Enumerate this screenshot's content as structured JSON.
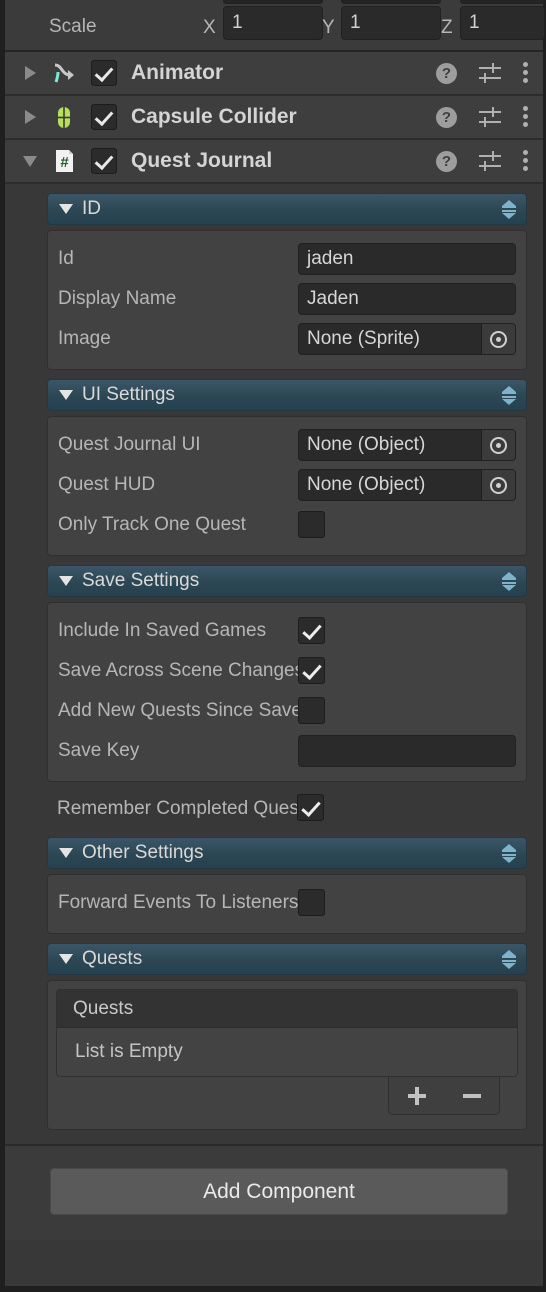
{
  "transform": {
    "scale_label": "Scale",
    "axes": [
      {
        "axis": "X",
        "value": "1"
      },
      {
        "axis": "Y",
        "value": "1"
      },
      {
        "axis": "Z",
        "value": "1"
      }
    ]
  },
  "components": [
    {
      "name": "Animator",
      "icon": "animator-icon",
      "enabled": true,
      "expanded": false
    },
    {
      "name": "Capsule Collider",
      "icon": "capsule-collider-icon",
      "enabled": true,
      "expanded": false
    },
    {
      "name": "Quest Journal",
      "icon": "csharp-script-icon",
      "enabled": true,
      "expanded": true
    }
  ],
  "header_tools": {
    "help": "?",
    "help_icon": "help-icon",
    "preset_icon": "preset-settings-icon",
    "menu_icon": "more-options-icon"
  },
  "sections": {
    "id": {
      "title": "ID",
      "rows": [
        {
          "label": "Id",
          "type": "text",
          "value": "jaden"
        },
        {
          "label": "Display Name",
          "type": "text",
          "value": "Jaden"
        },
        {
          "label": "Image",
          "type": "object",
          "value": "None (Sprite)"
        }
      ]
    },
    "ui_settings": {
      "title": "UI Settings",
      "rows": [
        {
          "label": "Quest Journal UI",
          "type": "object",
          "value": "None (Object)"
        },
        {
          "label": "Quest HUD",
          "type": "object",
          "value": "None (Object)"
        },
        {
          "label": "Only Track One Quest",
          "type": "checkbox",
          "checked": false
        }
      ]
    },
    "save_settings": {
      "title": "Save Settings",
      "rows": [
        {
          "label": "Include In Saved Games",
          "type": "checkbox",
          "checked": true
        },
        {
          "label": "Save Across Scene Changes",
          "type": "checkbox",
          "checked": true
        },
        {
          "label": "Add New Quests Since Save",
          "type": "checkbox",
          "checked": false
        },
        {
          "label": "Save Key",
          "type": "text",
          "value": ""
        }
      ]
    },
    "remember_completed": {
      "label": "Remember Completed Quests",
      "checked": true
    },
    "other_settings": {
      "title": "Other Settings",
      "rows": [
        {
          "label": "Forward Events To Listeners",
          "type": "checkbox",
          "checked": false
        }
      ]
    },
    "quests": {
      "title": "Quests",
      "list_header": "Quests",
      "empty_text": "List is Empty",
      "add_label": "+",
      "remove_label": "−"
    }
  },
  "footer": {
    "add_component_label": "Add Component"
  },
  "colors": {
    "background": "#383838",
    "section_header_blue": "#2c4654",
    "sort_arrow": "#7fb3cc",
    "collider_green": "#b5e05a",
    "field_bg": "#2a2a2a"
  }
}
